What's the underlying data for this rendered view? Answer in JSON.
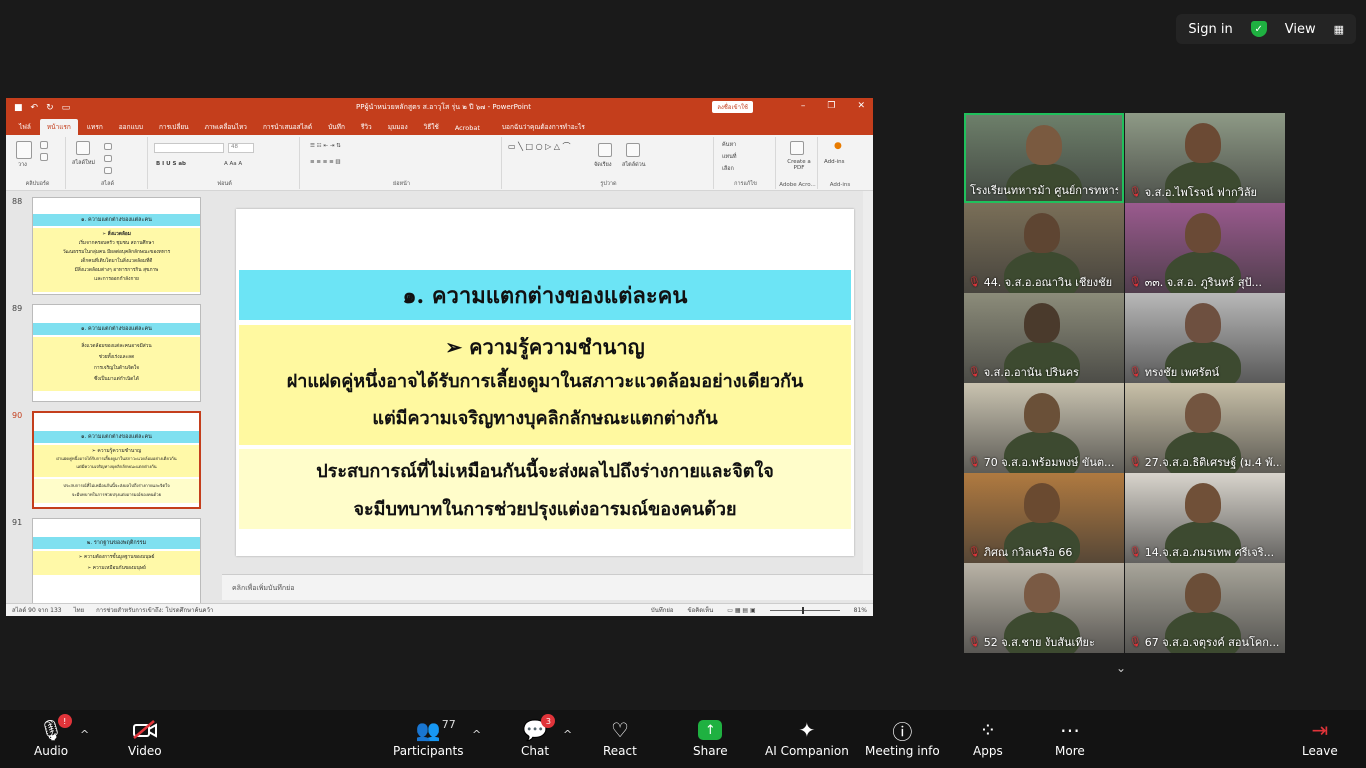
{
  "topbar": {
    "signin": "Sign in",
    "view": "View"
  },
  "ppt": {
    "filename": "PPผู้นำหน่วยหลักสูตร ส.อาวุโส รุ่น ๒ ปี ๖๗ - PowerPoint",
    "signin_button": "ลงชื่อเข้าใช้",
    "tabs": [
      "ไฟล์",
      "หน้าแรก",
      "แทรก",
      "ออกแบบ",
      "การเปลี่ยน",
      "ภาพเคลื่อนไหว",
      "การนำเสนอสไลด์",
      "บันทึก",
      "รีวิว",
      "มุมมอง",
      "วิธีใช้",
      "Acrobat"
    ],
    "tell_me": "บอกฉันว่าคุณต้องการทำอะไร",
    "ribbon": {
      "groups": [
        "คลิปบอร์ด",
        "สไลด์",
        "ฟอนต์",
        "ย่อหน้า",
        "รูปวาด",
        "การแก้ไข",
        "Adobe Acro...",
        "Add-ins"
      ],
      "paste": "วาง",
      "new_slide": "สไลด์ใหม่",
      "font_size": "48",
      "find": "ค้นหา",
      "replace": "แทนที่",
      "select": "เลือก",
      "create_pdf": "Create a PDF",
      "addins": "Add-ins",
      "arrange": "จัดเรียง",
      "quick_styles": "สไตล์ด่วน"
    },
    "thumbnails": [
      {
        "num": "88",
        "title": "๑. ความแตกต่างของแต่ละคน",
        "lines": [
          "➢ สิ่งแวดล้อม",
          "เริ่มจากครอบครัว ชุมชน สถานศึกษา",
          "วัฒนธรรมในกลุ่มคน มีผลต่อบุคลิกลักษณะของทหาร",
          "เด็กคนที่เติบโตมาในสิ่งแวดล้อมที่ดี",
          "มีสิ่งแวดล้อมต่างๆ อาหารการกิน สุขภาพ",
          "และการออกกำลังกาย"
        ]
      },
      {
        "num": "89",
        "title": "๑. ความแตกต่างของแต่ละคน",
        "lines": [
          "สิ่งแวดล้อมของแต่ละคนอาจมีส่วน",
          "ช่วยทั้งเร่งและลด",
          "การเจริญในด้านจิตใจ",
          "ซึ่งเป็นมาแต่กำเนิดได้"
        ]
      },
      {
        "num": "90",
        "title": "๑. ความแตกต่างของแต่ละคน",
        "lines": [
          "➢ ความรู้ความชำนาญ",
          "ฝาแฝดคู่หนึ่งอาจได้รับการเลี้ยงดูมาในสภาวะแวดล้อมอย่างเดียวกัน",
          "แต่มีความเจริญทางบุคลิกลักษณะแตกต่างกัน",
          "ประสบการณ์ที่ไม่เหมือนกันนี้จะส่งผลไปถึงร่างกายและจิตใจ",
          "จะมีบทบาทในการช่วยปรุงแต่งอารมณ์ของคนด้วย"
        ]
      },
      {
        "num": "91",
        "title": "๒. รากฐานของพฤติกรรม",
        "lines": [
          "➢ ความต้องการขั้นมูลฐานของมนุษย์",
          "➢ ความเหมือนกันของมนุษย์"
        ]
      }
    ],
    "slide": {
      "title": "๑. ความแตกต่างของแต่ละคน",
      "subtitle": "➢ ความรู้ความชำนาญ",
      "line1": "ฝาแฝดคู่หนึ่งอาจได้รับการเลี้ยงดูมาในสภาวะแวดล้อมอย่างเดียวกัน",
      "line2": "แต่มีความเจริญทางบุคลิกลักษณะแตกต่างกัน",
      "line3": "ประสบการณ์ที่ไม่เหมือนกันนี้จะส่งผลไปถึงร่างกายและจิตใจ",
      "line4": "จะมีบทบาทในการช่วยปรุงแต่งอารมณ์ของคนด้วย"
    },
    "notes_placeholder": "คลิกเพื่อเพิ่มบันทึกย่อ",
    "status": {
      "slide_count": "สไลด์ 90 จาก 133",
      "lang": "ไทย",
      "accessibility": "การช่วยสำหรับการเข้าถึง: โปรดศึกษาค้นคว้า",
      "notes": "บันทึกย่อ",
      "comments": "ข้อคิดเห็น",
      "zoom": "81%"
    }
  },
  "participants": [
    {
      "name": "โรงเรียนทหารม้า ศูนย์การทหารม้า",
      "muted": false,
      "active": true
    },
    {
      "name": "จ.ส.อ.ไพโรจน์ ฟากวิลัย",
      "muted": true,
      "active": false
    },
    {
      "name": "44. จ.ส.อ.อณาวิน เชียงชัย",
      "muted": true,
      "active": false
    },
    {
      "name": "๓๓. จ.ส.อ. ภูรินทร์ สุปั...",
      "muted": true,
      "active": false
    },
    {
      "name": "จ.ส.อ.อานัน ปรินคร",
      "muted": true,
      "active": false
    },
    {
      "name": "ทรงชัย เพศรัตน์",
      "muted": true,
      "active": false
    },
    {
      "name": "70 จ.ส.อ.พร้อมพงษ์ ขันต...",
      "muted": true,
      "active": false
    },
    {
      "name": "27.จ.ส.อ.ธิติเศรษฐ์ (ม.4 พั...",
      "muted": true,
      "active": false
    },
    {
      "name": "ภิศณ กวิลเครือ 66",
      "muted": true,
      "active": false
    },
    {
      "name": "14.จ.ส.อ.ภมรเทพ ศรีเจริ...",
      "muted": true,
      "active": false
    },
    {
      "name": "52 จ.ส.ชาย งับสันเทียะ",
      "muted": true,
      "active": false
    },
    {
      "name": "67 จ.ส.อ.จตุรงค์ สอนโคก...",
      "muted": true,
      "active": false
    }
  ],
  "toolbar": {
    "audio": "Audio",
    "audio_badge": "!",
    "video": "Video",
    "participants": "Participants",
    "participants_count": "77",
    "chat": "Chat",
    "chat_badge": "3",
    "react": "React",
    "share": "Share",
    "ai": "AI Companion",
    "info": "Meeting info",
    "apps": "Apps",
    "more": "More",
    "leave": "Leave"
  }
}
